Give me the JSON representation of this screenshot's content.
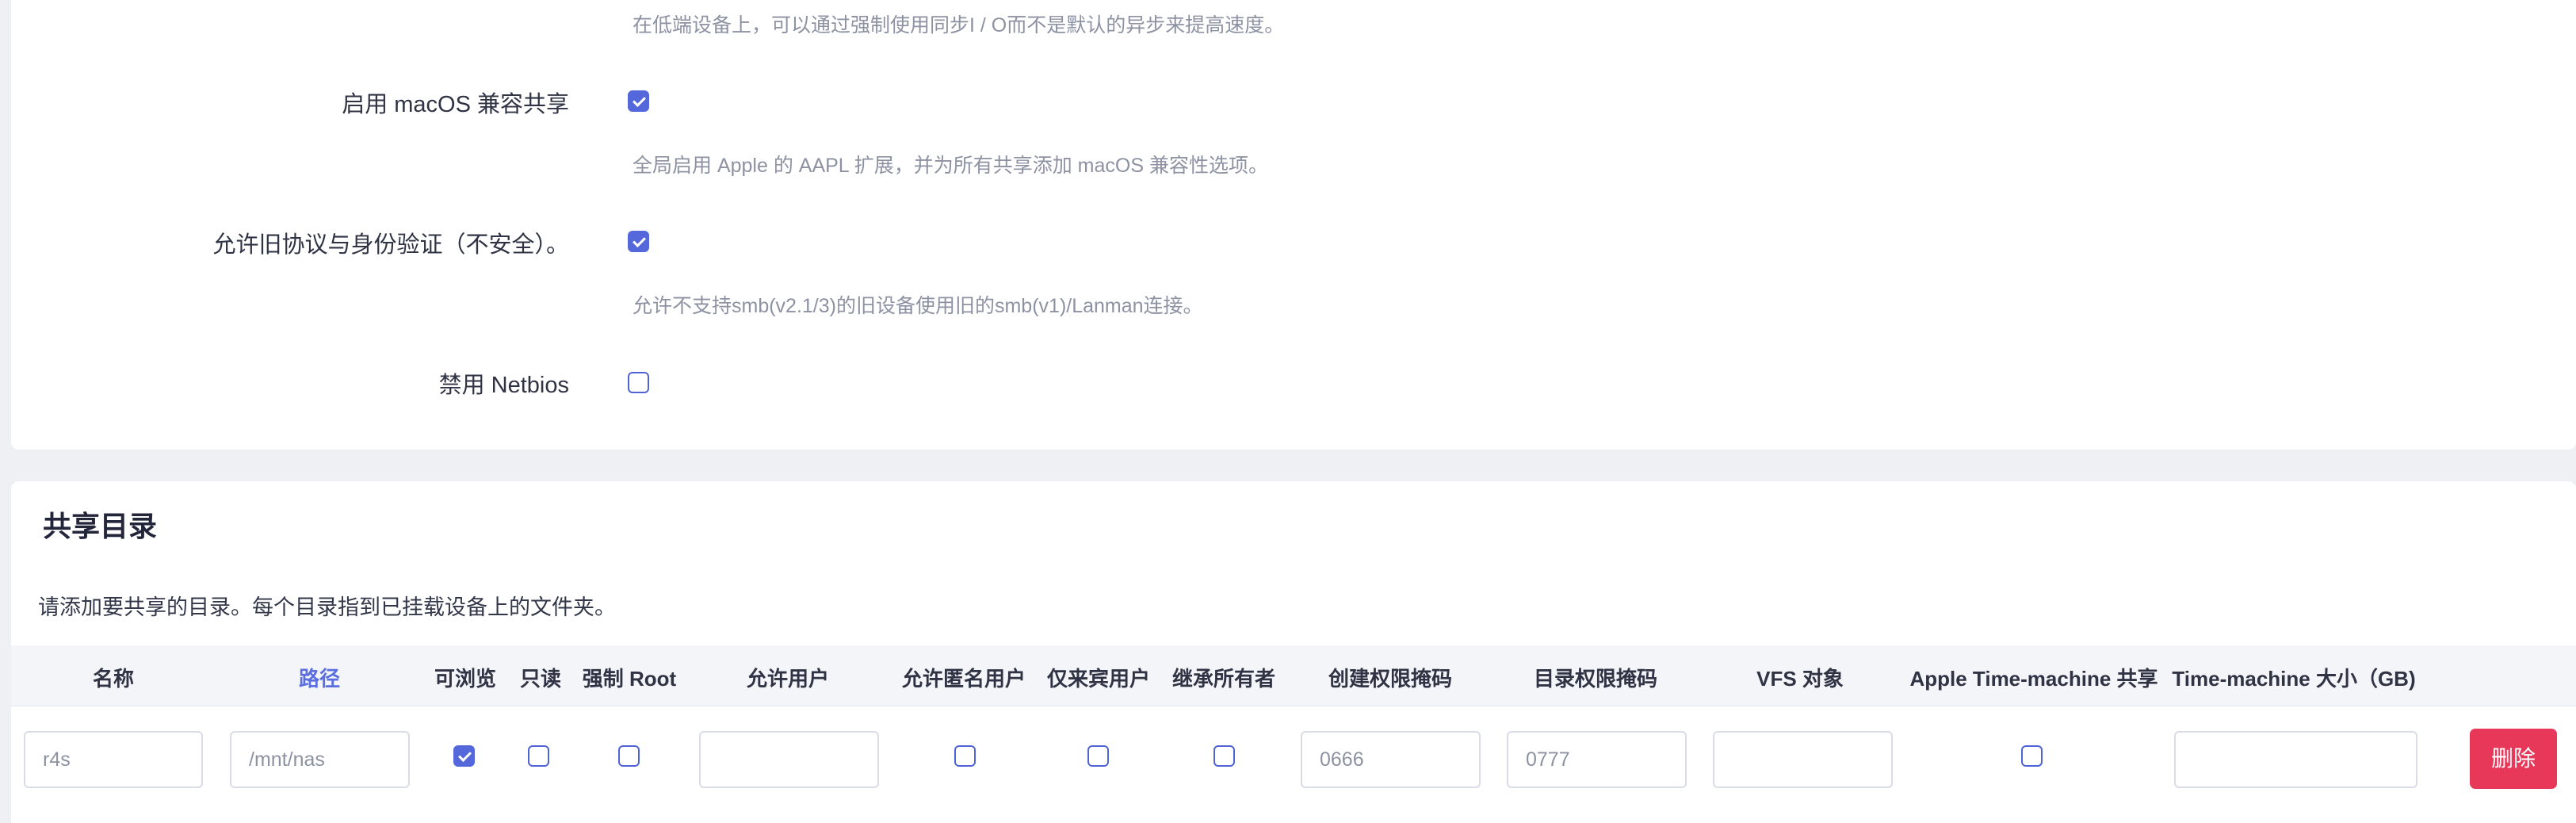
{
  "settings": {
    "async_io_desc": "在低端设备上，可以通过强制使用同步I / O而不是默认的异步来提高速度。",
    "macos": {
      "label": "启用 macOS 兼容共享",
      "checked": true,
      "desc": "全局启用 Apple 的 AAPL 扩展，并为所有共享添加 macOS 兼容性选项。"
    },
    "legacy": {
      "label": "允许旧协议与身份验证（不安全）。",
      "checked": true,
      "desc": "允许不支持smb(v2.1/3)的旧设备使用旧的smb(v1)/Lanman连接。"
    },
    "netbios": {
      "label": "禁用 Netbios",
      "checked": false
    }
  },
  "shares": {
    "title": "共享目录",
    "description": "请添加要共享的目录。每个目录指到已挂载设备上的文件夹。",
    "columns": {
      "name": "名称",
      "path": "路径",
      "browseable": "可浏览",
      "read_only": "只读",
      "force_root": "强制 Root",
      "allowed_users": "允许用户",
      "guest_ok": "允许匿名用户",
      "guest_only": "仅来宾用户",
      "inherit_owner": "继承所有者",
      "create_mask": "创建权限掩码",
      "dir_mask": "目录权限掩码",
      "vfs_objects": "VFS 对象",
      "timemachine": "Apple Time-machine 共享",
      "timemachine_size": "Time-machine 大小（GB)"
    },
    "row": {
      "name_placeholder": "r4s",
      "path_placeholder": "/mnt/nas",
      "browseable": true,
      "read_only": false,
      "force_root": false,
      "allowed_users": "",
      "guest_ok": false,
      "guest_only": false,
      "inherit_owner": false,
      "create_mask_placeholder": "0666",
      "dir_mask_placeholder": "0777",
      "vfs_objects": "",
      "timemachine": false,
      "timemachine_size": "",
      "delete_label": "删除"
    }
  }
}
